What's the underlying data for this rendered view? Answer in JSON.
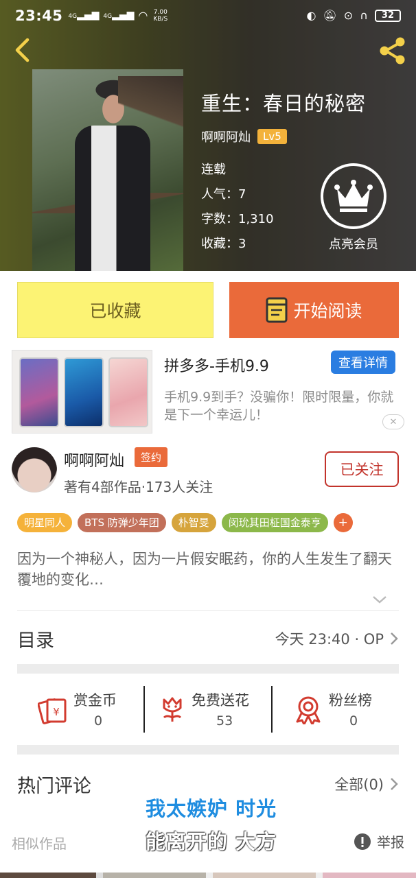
{
  "status_bar": {
    "time": "23:45",
    "net1": "4G",
    "net2": "4G",
    "speed_value": "7.00",
    "speed_unit": "KB/S",
    "battery": "32"
  },
  "book": {
    "title": "重生：春日的秘密",
    "author": "啊啊阿灿",
    "level": "Lv5",
    "status": "连载",
    "popularity": "人气：7",
    "word_count": "字数：1,310",
    "favorites": "收藏：3"
  },
  "vip": {
    "label": "点亮会员"
  },
  "actions": {
    "favorited_label": "已收藏",
    "read_label": "开始阅读"
  },
  "ad": {
    "title": "拼多多-手机9.9",
    "button": "查看详情",
    "description": "手机9.9到手？没骗你！限时限量，你就是下一个幸运儿！",
    "close": "✕"
  },
  "author_card": {
    "name": "啊啊阿灿",
    "badge": "签约",
    "stats": "著有4部作品·173人关注",
    "follow_label": "已关注"
  },
  "tags": [
    {
      "label": "明星同人",
      "color": "#f5b23a"
    },
    {
      "label": "BTS 防弹少年团",
      "color": "#c2705a"
    },
    {
      "label": "朴智旻",
      "color": "#d6a43c"
    },
    {
      "label": "闵玧其田柾国金泰亨",
      "color": "#8cb84a"
    }
  ],
  "tag_more": "+",
  "summary": "因为一个神秘人，因为一片假安眠药，你的人生发生了翻天覆地的变化…",
  "toc": {
    "title": "目录",
    "update": "今天 23:40 · OP"
  },
  "stats": [
    {
      "label": "赏金币",
      "value": "0",
      "icon": "coin-envelope-icon"
    },
    {
      "label": "免费送花",
      "value": "53",
      "icon": "flower-icon"
    },
    {
      "label": "粉丝榜",
      "value": "0",
      "icon": "medal-icon"
    }
  ],
  "comments": {
    "title": "热门评论",
    "all": "全部(0)"
  },
  "similar": "相似作品",
  "report": "举报",
  "overlay_subtitles": {
    "line1": "我太嫉妒 时光",
    "line2": "能离开的 大方"
  },
  "colors": {
    "accent_orange": "#ea6a3a",
    "fav_yellow": "#fcf374",
    "ad_blue": "#2a7de1",
    "follow_red": "#c2332b"
  }
}
